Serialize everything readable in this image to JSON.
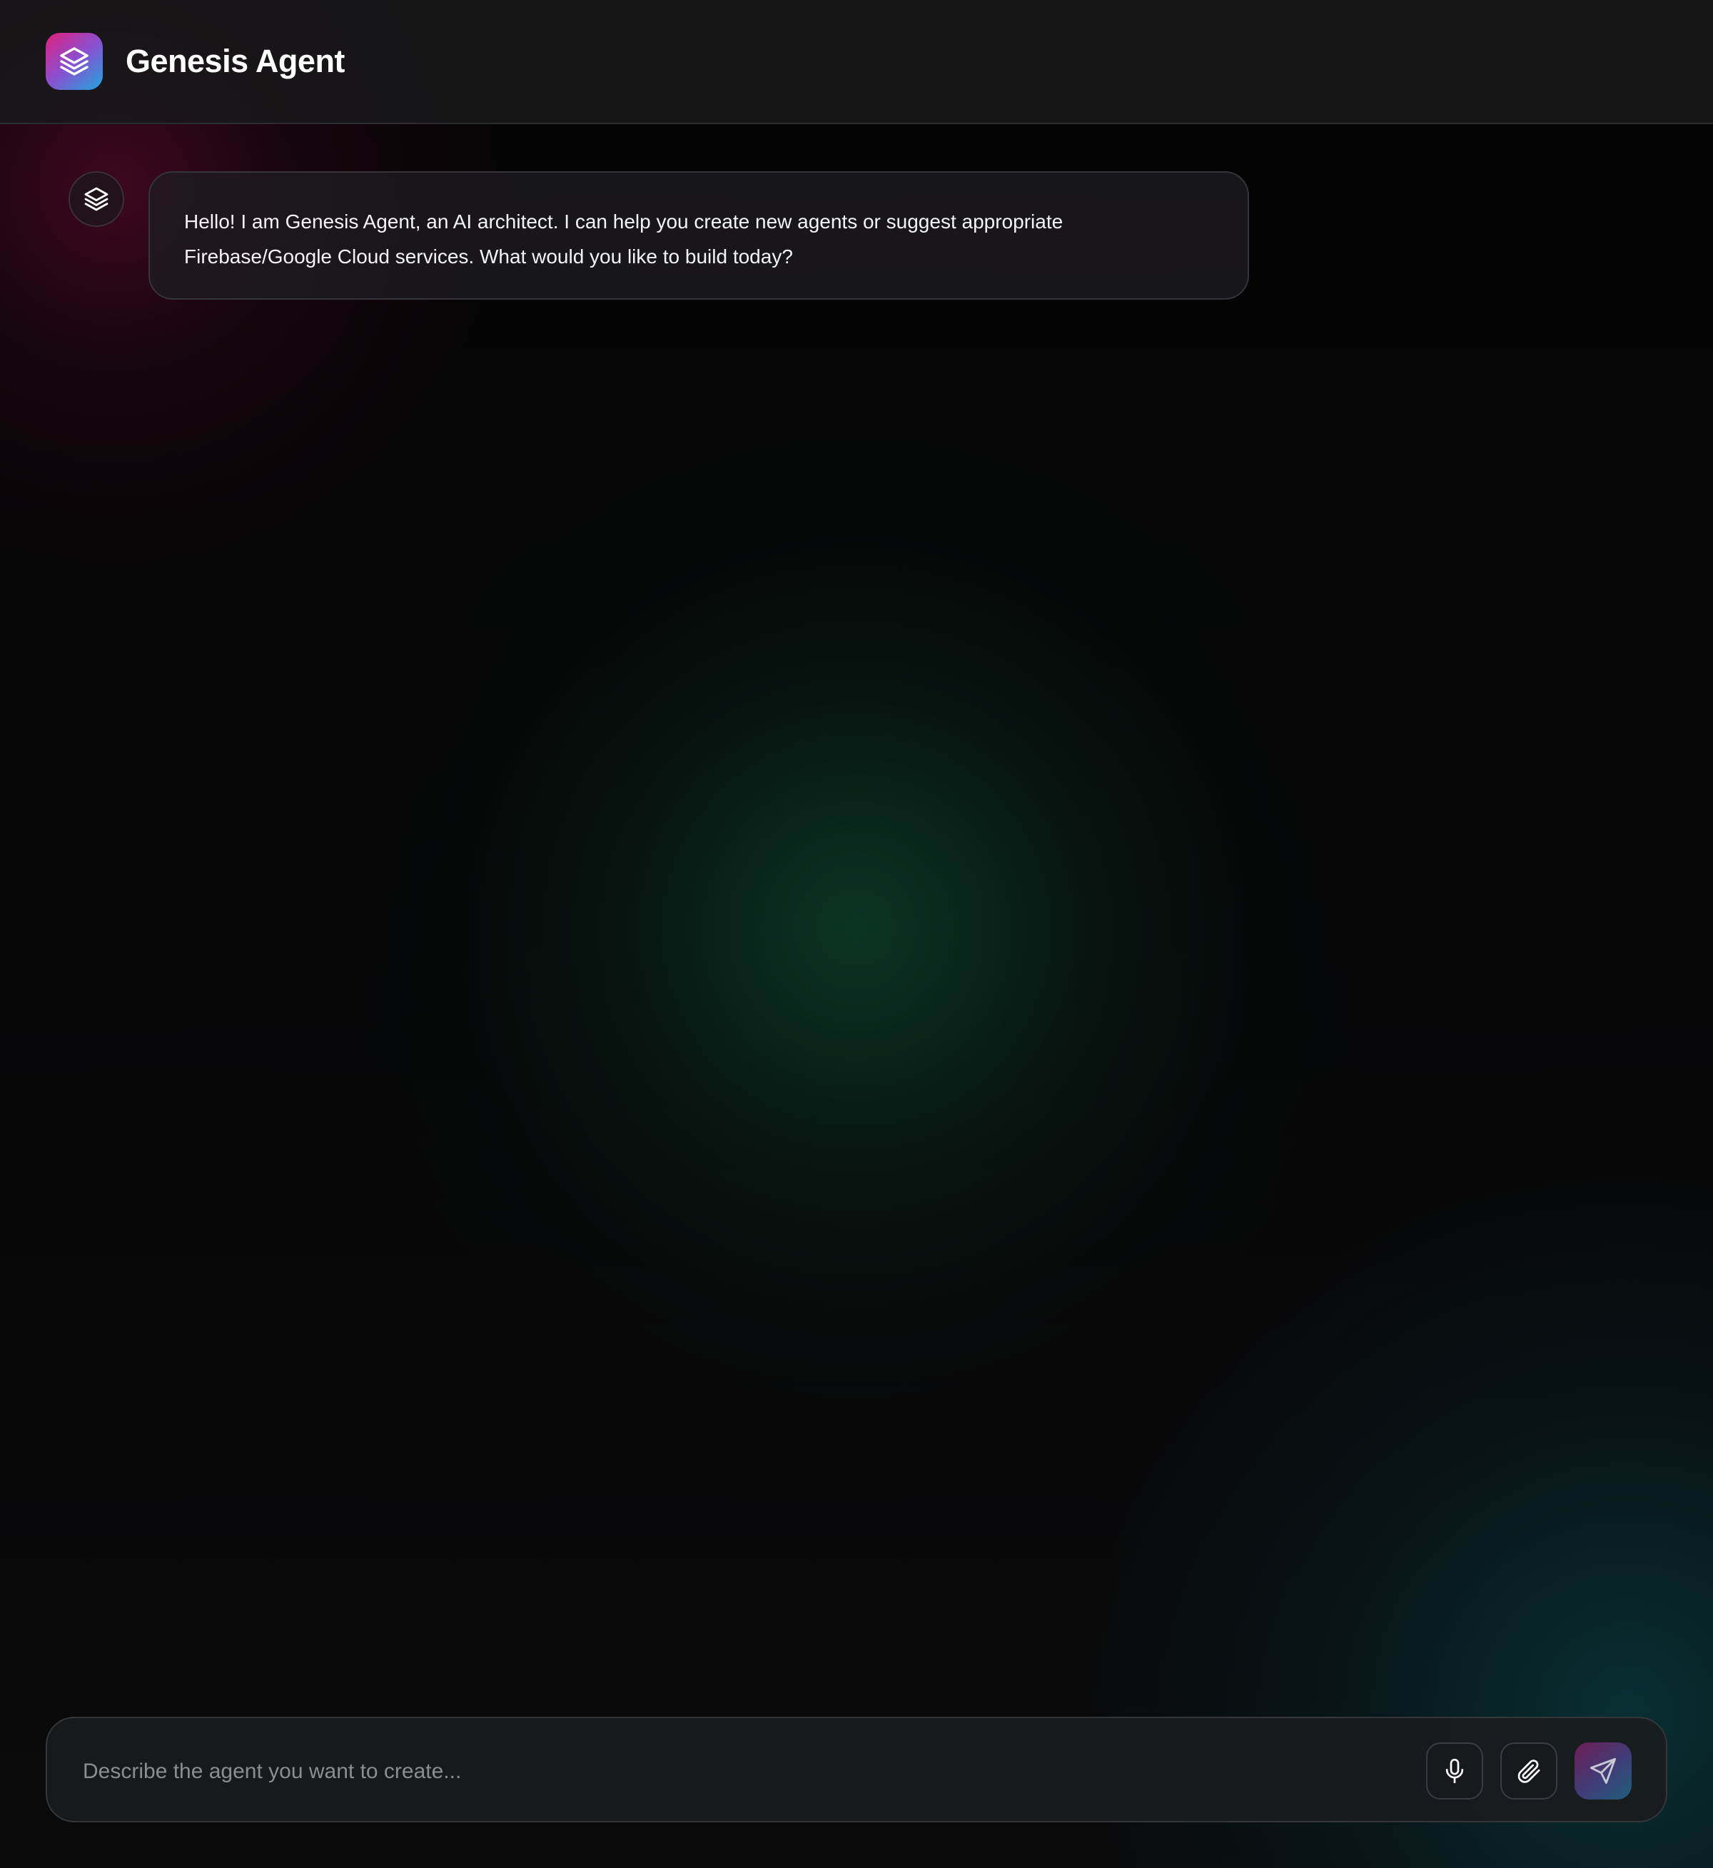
{
  "header": {
    "app_title": "Genesis Agent",
    "logo_icon": "layers-icon"
  },
  "chat": {
    "messages": [
      {
        "role": "agent",
        "avatar_icon": "layers-icon",
        "text": "Hello! I am Genesis Agent, an AI architect. I can help you create new agents or suggest appropriate Firebase/Google Cloud services. What would you like to build today?"
      }
    ]
  },
  "composer": {
    "placeholder": "Describe the agent you want to create...",
    "value": "",
    "buttons": {
      "mic_icon": "microphone-icon",
      "attach_icon": "paperclip-icon",
      "send_icon": "send-icon"
    }
  },
  "colors": {
    "background": "#050506",
    "logo_gradient_start": "#e0207c",
    "logo_gradient_mid": "#8a4fd0",
    "logo_gradient_end": "#1fa7de",
    "glow_green": "#105c3e",
    "glow_teal": "#084e56",
    "glow_magenta": "#6e0a34"
  }
}
